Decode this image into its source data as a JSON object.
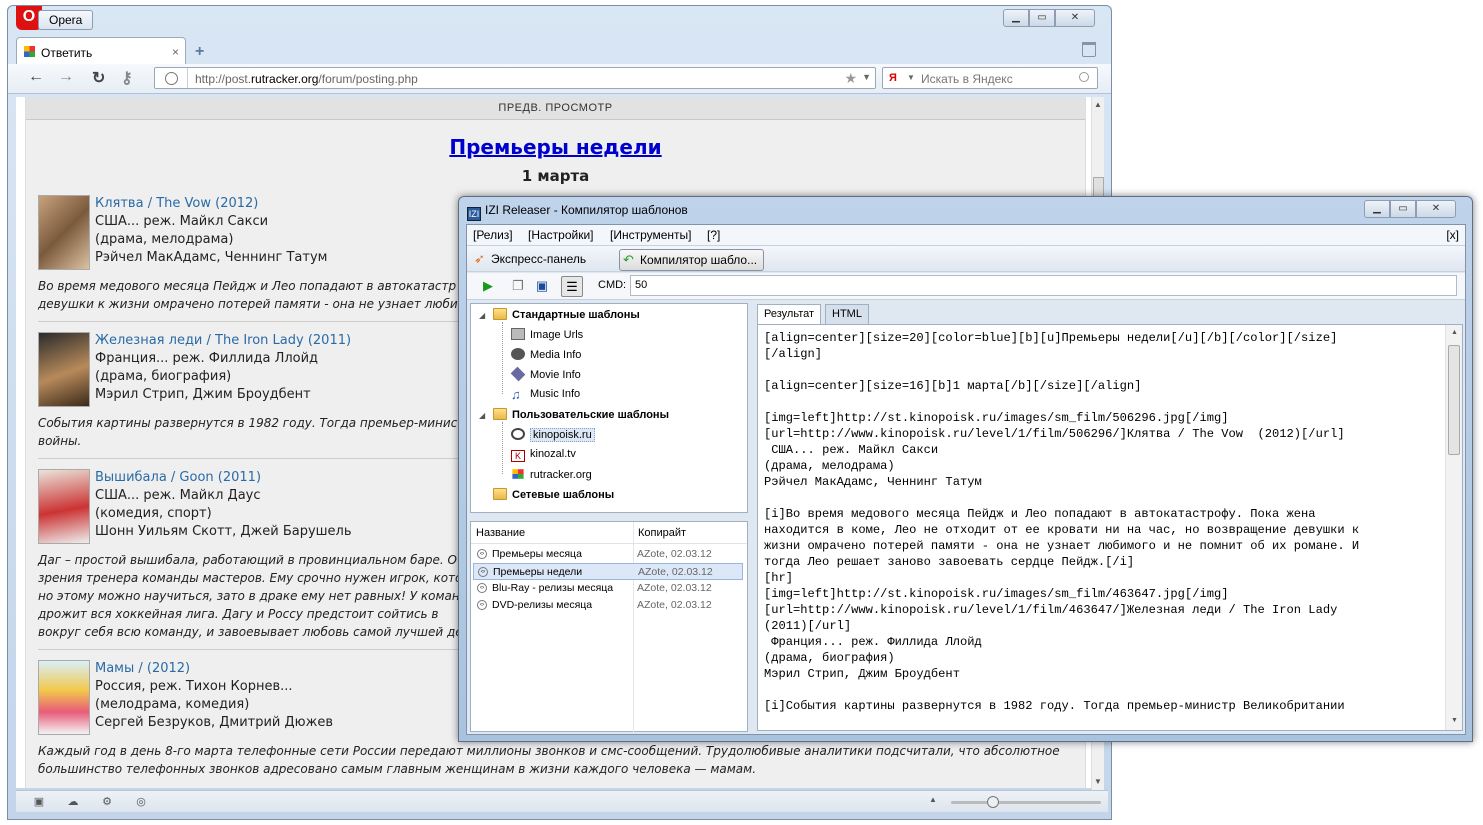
{
  "opera": {
    "menu_label": "Opera",
    "tab": {
      "title": "Ответить",
      "close": "×"
    },
    "url": {
      "prefix": "http://post.",
      "domain": "rutracker.org",
      "path": "/forum/posting.php"
    },
    "search_placeholder": "Искать в Яндекс",
    "search_engine_badge": "Я",
    "page": {
      "preview_header": "ПРЕДВ. ПРОСМОТР",
      "title": "Премьеры недели",
      "date": "1 марта",
      "movies": [
        {
          "title": "Клятва / The Vow (2012)",
          "line1": "США... реж. Майкл Сакси",
          "line2": "(драма, мелодрама)",
          "line3": "Рэйчел МакАдамс, Ченнинг Татум",
          "desc": [
            "Во время медового месяца Пейдж и Лео попадают в автокатастр",
            "девушки к жизни омрачено потерей памяти - она не узнает любим"
          ]
        },
        {
          "title": "Железная леди / The Iron Lady (2011)",
          "line1": "Франция... реж. Филлида Ллойд",
          "line2": "(драма, биография)",
          "line3": "Мэрил Стрип, Джим Броудбент",
          "desc": [
            "События картины развернутся в 1982 году. Тогда премьер-минист",
            "войны."
          ]
        },
        {
          "title": "Вышибала / Goon (2011)",
          "line1": "США... реж. Майкл Даус",
          "line2": "(комедия, спорт)",
          "line3": "Шонн Уильям Скотт, Джей Барушель",
          "desc": [
            "Даг – простой вышибала, работающий в провинциальном баре. О",
            "зрения тренера команды мастеров. Ему срочно нужен игрок, котор",
            "но этому можно научиться, зато в драке ему нет равных! У команд",
            "дрожит вся хоккейная лига. Дагу и Россу предстоит сойтись в",
            "вокруг себя всю команду, и завоевывает любовь самой лучшей де"
          ]
        },
        {
          "title": "Мамы / (2012)",
          "line1": "Россия, реж. Тихон Корнев...",
          "line2": "(мелодрама, комедия)",
          "line3": "Сергей Безруков, Дмитрий Дюжев",
          "desc": [
            "Каждый год в день 8-го марта телефонные сети России передают миллионы звонков и смс-сообщений. Трудолюбивые аналитики подсчитали, что абсолютное",
            "большинство телефонных звонков адресовано самым главным женщинам в жизни каждого человека — мамам."
          ]
        }
      ]
    }
  },
  "izi": {
    "title": "IZI Releaser - Компилятор шаблонов",
    "app_badge": "IZI",
    "menu": [
      "[Релиз]",
      "[Настройки]",
      "[Инструменты]",
      "[?]"
    ],
    "menu_close": "[x]",
    "toolbar": {
      "express": "Экспресс-панель",
      "compiler": "Компилятор шабло..."
    },
    "cmd_label": "CMD:",
    "cmd_value": "50",
    "tree": {
      "standard": "Стандартные шаблоны",
      "standard_items": [
        "Image Urls",
        "Media Info",
        "Movie Info",
        "Music Info"
      ],
      "user": "Пользовательские шаблоны",
      "user_items": [
        "kinopoisk.ru",
        "kinozal.tv",
        "rutracker.org"
      ],
      "network": "Сетевые шаблоны"
    },
    "list": {
      "col_name": "Название",
      "col_copyright": "Копирайт",
      "rows": [
        {
          "name": "Премьеры месяца",
          "copyright": "AZote, 02.03.12"
        },
        {
          "name": "Премьеры недели",
          "copyright": "AZote, 02.03.12"
        },
        {
          "name": "Blu-Ray - релизы месяца",
          "copyright": "AZote, 02.03.12"
        },
        {
          "name": "DVD-релизы месяца",
          "copyright": "AZote, 02.03.12"
        }
      ]
    },
    "tabs": [
      "Результат",
      "HTML"
    ],
    "result_text": "[align=center][size=20][color=blue][b][u]Премьеры недели[/u][/b][/color][/size]\n[/align]\n\n[align=center][size=16][b]1 марта[/b][/size][/align]\n\n[img=left]http://st.kinopoisk.ru/images/sm_film/506296.jpg[/img]\n[url=http://www.kinopoisk.ru/level/1/film/506296/]Клятва / The Vow  (2012)[/url]\n США... реж. Майкл Сакси\n(драма, мелодрама)\nРэйчел МакАдамс, Ченнинг Татум\n\n[i]Во время медового месяца Пейдж и Лео попадают в автокатастрофу. Пока жена\nнаходится в коме, Лео не отходит от ее кровати ни на час, но возвращение девушки к\nжизни омрачено потерей памяти - она не узнает любимого и не помнит об их романе. И\nтогда Лео решает заново завоевать сердце Пейдж.[/i]\n[hr]\n[img=left]http://st.kinopoisk.ru/images/sm_film/463647.jpg[/img]\n[url=http://www.kinopoisk.ru/level/1/film/463647/]Железная леди / The Iron Lady\n(2011)[/url]\n Франция... реж. Филлида Ллойд\n(драма, биография)\nМэрил Стрип, Джим Броудбент\n\n[i]События картины развернутся в 1982 году. Тогда премьер-министр Великобритании"
  },
  "colors": {
    "link": "#2a6aa5",
    "title_link": "#0000cc",
    "accent": "#bfd3ea"
  }
}
